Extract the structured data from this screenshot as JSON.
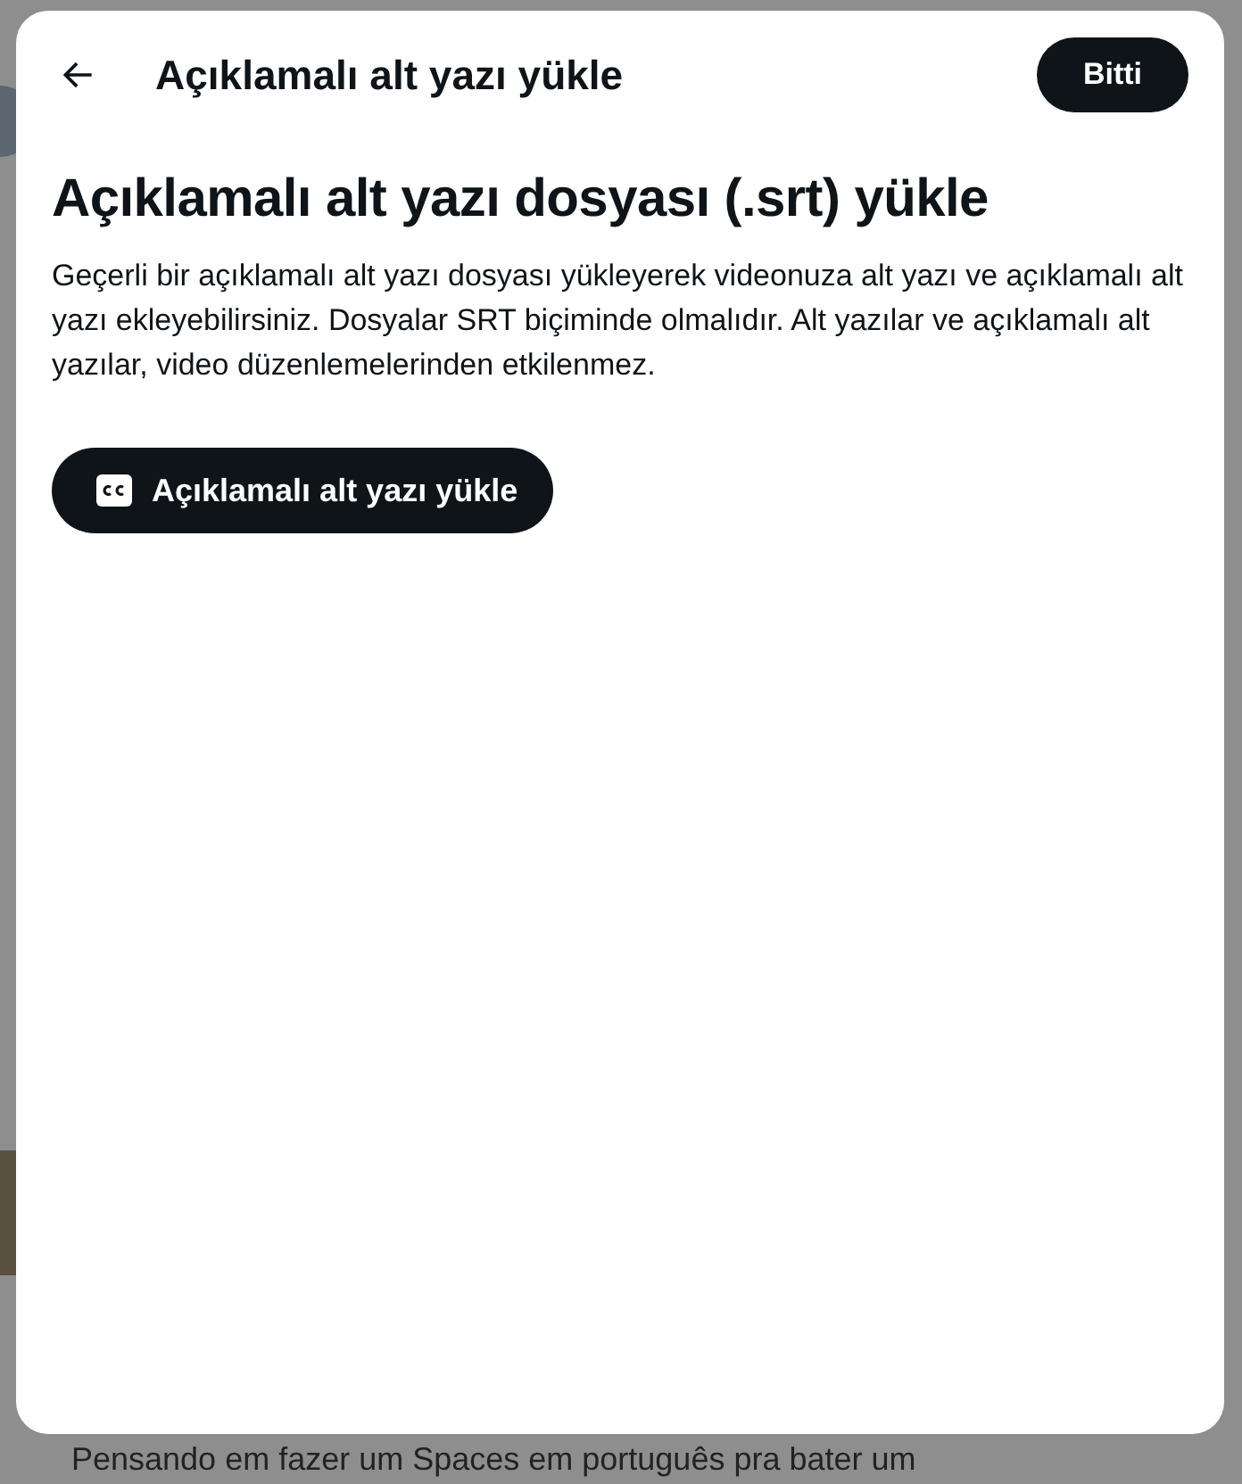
{
  "modal": {
    "title": "Açıklamalı alt yazı yükle",
    "done_button": "Bitti",
    "heading": "Açıklamalı alt yazı dosyası (.srt) yükle",
    "description": "Geçerli bir açıklamalı alt yazı dosyası yükleyerek videonuza alt yazı ve açıklamalı alt yazı ekleyebilirsiniz. Dosyalar SRT biçiminde olmalıdır. Alt yazılar ve açıklamalı alt yazılar, video düzenlemelerinden etkilenmez.",
    "upload_button": "Açıklamalı alt yazı yükle"
  },
  "background": {
    "post_text": "Pensando em fazer um Spaces em português pra bater um"
  }
}
